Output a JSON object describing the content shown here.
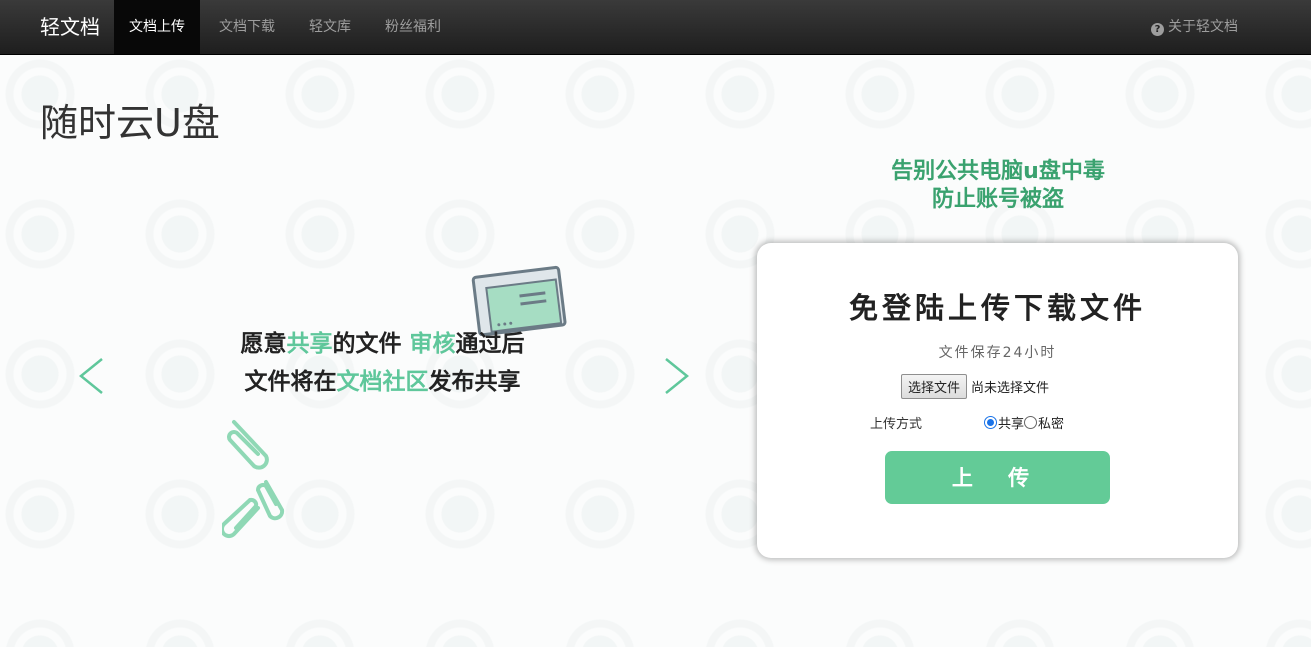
{
  "nav": {
    "brand": "轻文档",
    "items": [
      {
        "label": "文档上传",
        "active": true
      },
      {
        "label": "文档下载",
        "active": false
      },
      {
        "label": "轻文库",
        "active": false
      },
      {
        "label": "粉丝福利",
        "active": false
      }
    ],
    "about": "关于轻文档"
  },
  "page_title": "随时云U盘",
  "slogan": {
    "line1": "告别公共电脑u盘中毒",
    "line2": "防止账号被盗"
  },
  "carousel": {
    "line1_a": "愿意",
    "line1_b": "共享",
    "line1_c": "的文件 ",
    "line1_d": "审核",
    "line1_e": "通过后",
    "line2_a": "文件将在",
    "line2_b": "文档社区",
    "line2_c": "发布共享"
  },
  "upload_card": {
    "title": "免登陆上传下载文件",
    "subtitle": "文件保存24小时",
    "choose_file_label": "选择文件",
    "no_file_text": "尚未选择文件",
    "mode_label": "上传方式",
    "modes": [
      {
        "label": "共享",
        "selected": true
      },
      {
        "label": "私密",
        "selected": false
      }
    ],
    "upload_button": "上 传"
  },
  "colors": {
    "accent": "#63cb97",
    "slogan": "#3aa26f",
    "highlight": "#5fc79b",
    "nav_bg": "#222222"
  }
}
